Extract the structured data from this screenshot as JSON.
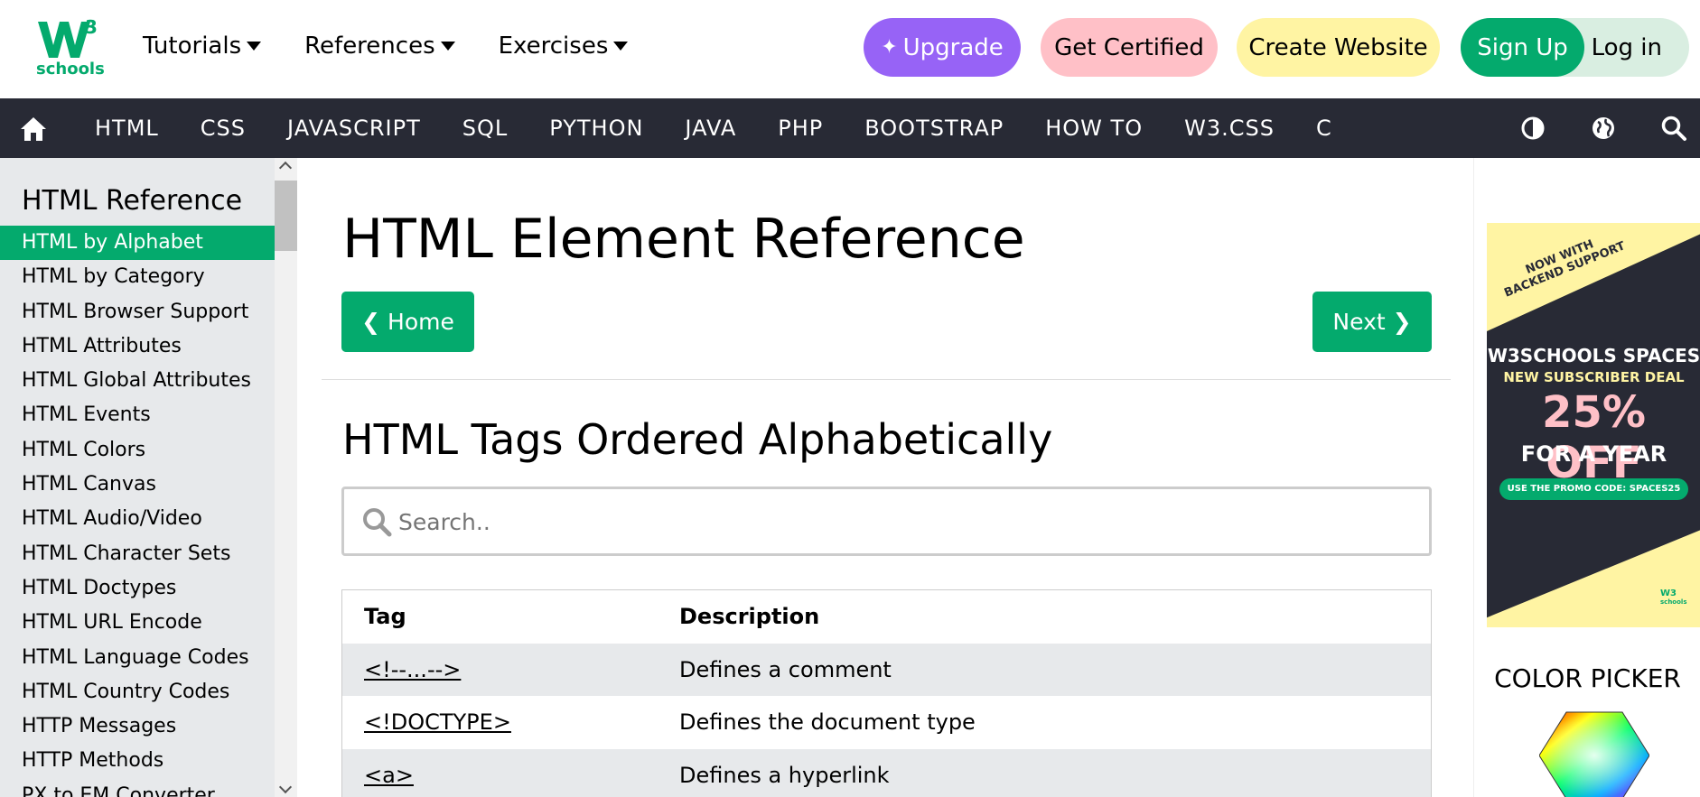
{
  "logo": {
    "superscript": "3",
    "text": "schools"
  },
  "topnav": [
    {
      "label": "Tutorials"
    },
    {
      "label": "References"
    },
    {
      "label": "Exercises"
    }
  ],
  "actions": {
    "upgrade": "Upgrade",
    "get_certified": "Get Certified",
    "create_website": "Create Website",
    "sign_up": "Sign Up",
    "log_in": "Log in"
  },
  "colors": {
    "brand_green": "#04AA6D",
    "dark_nav": "#282A35",
    "upgrade_purple": "#9763f6",
    "cert_pink": "#ffc0c7",
    "create_yellow": "#fff4a3",
    "sidebar_gray": "#E7E9EB"
  },
  "darknav": {
    "home_icon": "home-icon",
    "items": [
      "HTML",
      "CSS",
      "JAVASCRIPT",
      "SQL",
      "PYTHON",
      "JAVA",
      "PHP",
      "BOOTSTRAP",
      "HOW TO",
      "W3.CSS",
      "C"
    ],
    "right_icons": [
      "contrast-icon",
      "globe-icon",
      "search-icon"
    ]
  },
  "sidebar": {
    "title": "HTML Reference",
    "items": [
      {
        "label": "HTML by Alphabet",
        "active": true
      },
      {
        "label": "HTML by Category"
      },
      {
        "label": "HTML Browser Support"
      },
      {
        "label": "HTML Attributes"
      },
      {
        "label": "HTML Global Attributes"
      },
      {
        "label": "HTML Events"
      },
      {
        "label": "HTML Colors"
      },
      {
        "label": "HTML Canvas"
      },
      {
        "label": "HTML Audio/Video"
      },
      {
        "label": "HTML Character Sets"
      },
      {
        "label": "HTML Doctypes"
      },
      {
        "label": "HTML URL Encode"
      },
      {
        "label": "HTML Language Codes"
      },
      {
        "label": "HTML Country Codes"
      },
      {
        "label": "HTTP Messages"
      },
      {
        "label": "HTTP Methods"
      },
      {
        "label": "PX to EM Converter"
      }
    ]
  },
  "main": {
    "title": "HTML Element Reference",
    "home_button": "Home",
    "next_button": "Next",
    "subtitle": "HTML Tags Ordered Alphabetically",
    "search_placeholder": "Search..",
    "table": {
      "headers": [
        "Tag",
        "Description"
      ],
      "rows": [
        {
          "tag": "<!--...-->",
          "desc": "Defines a comment"
        },
        {
          "tag": "<!DOCTYPE>",
          "desc": "Defines the document type"
        },
        {
          "tag": "<a>",
          "desc": "Defines a hyperlink"
        }
      ]
    }
  },
  "ad": {
    "tagline_1": "NOW WITH",
    "tagline_2": "BACKEND SUPPORT",
    "spaces": "W3SCHOOLS SPACES",
    "deal": "NEW SUBSCRIBER DEAL",
    "discount": "25% OFF",
    "period": "FOR A YEAR",
    "promo": "USE THE PROMO CODE: SPACES25",
    "mini_logo": "W3",
    "mini_logo_sub": "schools"
  },
  "color_picker": {
    "title": "COLOR PICKER"
  }
}
